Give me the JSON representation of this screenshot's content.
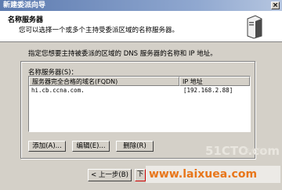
{
  "window": {
    "title": "新建委派向导",
    "close_glyph": "×"
  },
  "header": {
    "title": "名称服务器",
    "subtitle": "您可以选择一个或多个主持受委派区域的名称服务器。",
    "icon": "server-icon"
  },
  "body": {
    "instruction": "指定您想要主持被委派的区域的 DNS 服务器的名称和 IP 地址。",
    "list_label": "名称服务器(S)：",
    "columns": {
      "fqdn": "服务器完全合格的域名(FQDN)",
      "ip": "IP 地址"
    },
    "rows": [
      {
        "fqdn": "hi.cb.ccna.com.",
        "ip": "[192.168.2.88]"
      }
    ]
  },
  "buttons": {
    "add": "添加(A)...",
    "edit": "编辑(E)...",
    "delete": "删除(R)",
    "back": "< 上一步(B)",
    "next": "下"
  },
  "watermarks": {
    "brand": "51CTO.com",
    "brand_sub": "技术博客",
    "site": "www.laixuea.com"
  },
  "colors": {
    "watermark_site": "#e8761a",
    "next_focus_border": "#cc0000"
  }
}
